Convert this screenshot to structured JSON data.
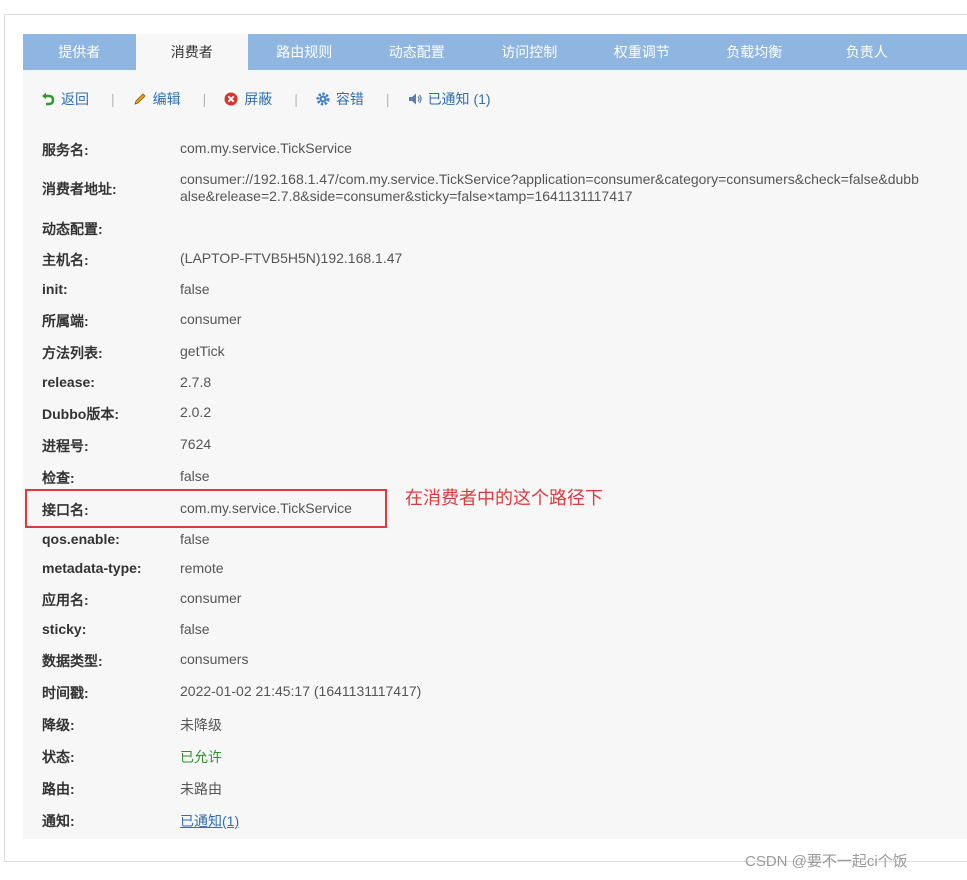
{
  "tabs": [
    "提供者",
    "消费者",
    "路由规则",
    "动态配置",
    "访问控制",
    "权重调节",
    "负载均衡",
    "负责人"
  ],
  "active_tab": "消费者",
  "toolbar": {
    "back": "返回",
    "edit": "编辑",
    "shield": "屏蔽",
    "fault": "容错",
    "notified": "已通知 (1)",
    "separator": "|"
  },
  "details": {
    "service_name": {
      "label": "服务名:",
      "value": "com.my.service.TickService"
    },
    "consumer_addr": {
      "label": "消费者地址:",
      "line1": "consumer://192.168.1.47/com.my.service.TickService?application=consumer&category=consumers&check=false&dubb",
      "line2": "alse&release=2.7.8&side=consumer&sticky=false×tamp=1641131117417"
    },
    "dynamic_config": {
      "label": "动态配置:",
      "value": ""
    },
    "host": {
      "label": "主机名:",
      "value": "(LAPTOP-FTVB5H5N)192.168.1.47"
    },
    "init": {
      "label": "init:",
      "value": "false"
    },
    "side": {
      "label": "所属端:",
      "value": "consumer"
    },
    "methods": {
      "label": "方法列表:",
      "value": "getTick"
    },
    "release": {
      "label": "release:",
      "value": "2.7.8"
    },
    "dubbo_version": {
      "label": "Dubbo版本:",
      "value": "2.0.2"
    },
    "pid": {
      "label": "进程号:",
      "value": "7624"
    },
    "check": {
      "label": "检查:",
      "value": "false"
    },
    "interface": {
      "label": "接口名:",
      "value": "com.my.service.TickService"
    },
    "qos": {
      "label": "qos.enable:",
      "value": "false"
    },
    "metadata": {
      "label": "metadata-type:",
      "value": "remote"
    },
    "app": {
      "label": "应用名:",
      "value": "consumer"
    },
    "sticky": {
      "label": "sticky:",
      "value": "false"
    },
    "category": {
      "label": "数据类型:",
      "value": "consumers"
    },
    "timestamp": {
      "label": "时间戳:",
      "value": "2022-01-02 21:45:17 (1641131117417)"
    },
    "degrade": {
      "label": "降级:",
      "value": "未降级"
    },
    "status": {
      "label": "状态:",
      "value": "已允许"
    },
    "route": {
      "label": "路由:",
      "value": "未路由"
    },
    "notify": {
      "label": "通知:",
      "value": "已通知(1)"
    }
  },
  "annotation": "在消费者中的这个路径下",
  "watermark": "CSDN @要不一起ci个饭",
  "colors": {
    "tab_bar": "#8fb6e0",
    "link": "#2f6fb5",
    "highlight": "#e03b3b",
    "allowed": "#2f8f2f"
  }
}
